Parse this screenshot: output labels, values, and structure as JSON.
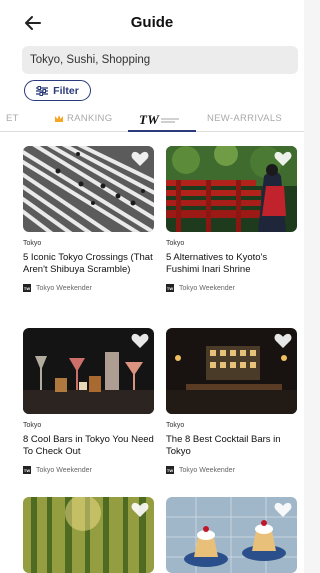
{
  "header": {
    "title": "Guide"
  },
  "search": {
    "value": "Tokyo, Sushi, Shopping"
  },
  "filter": {
    "label": "Filter"
  },
  "tabs": [
    {
      "label": "ET"
    },
    {
      "label": "RANKING"
    },
    {
      "label": "TW"
    },
    {
      "label": "NEW-ARRIVALS"
    }
  ],
  "cards": [
    {
      "category": "Tokyo",
      "headline": "5 Iconic Tokyo Crossings (That Aren't Shibuya Scramble)",
      "source": "Tokyo Weekender",
      "source_icon": "TW"
    },
    {
      "category": "Tokyo",
      "headline": "5 Alternatives to Kyoto's Fushimi Inari Shrine",
      "source": "Tokyo Weekender",
      "source_icon": "TW"
    },
    {
      "category": "Tokyo",
      "headline": "8 Cool Bars in Tokyo You Need To Check Out",
      "source": "Tokyo Weekender",
      "source_icon": "TW"
    },
    {
      "category": "Tokyo",
      "headline": "The 8 Best Cocktail Bars in Tokyo",
      "source": "Tokyo Weekender",
      "source_icon": "TW"
    },
    {
      "category": "",
      "headline": "",
      "source": "",
      "source_icon": ""
    },
    {
      "category": "",
      "headline": "",
      "source": "",
      "source_icon": ""
    }
  ],
  "colors": {
    "accent": "#2b3a7a",
    "ranking_star": "#f5a623"
  }
}
